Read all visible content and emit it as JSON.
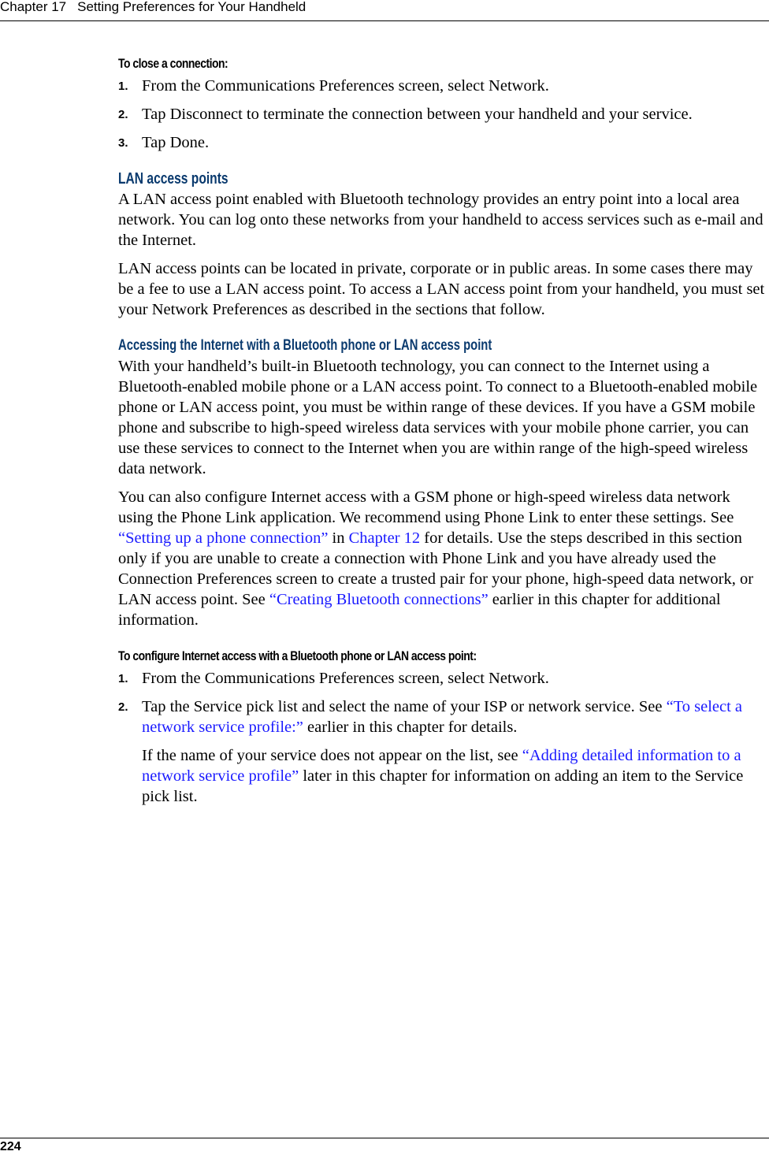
{
  "header": {
    "chapter": "Chapter 17",
    "title": "Setting Preferences for Your Handheld"
  },
  "footer": {
    "page_number": "224"
  },
  "close_connection": {
    "title": "To close a connection:",
    "steps": [
      {
        "num": "1.",
        "text": "From the Communications Preferences screen, select Network."
      },
      {
        "num": "2.",
        "text": "Tap Disconnect to terminate the connection between your handheld and your service."
      },
      {
        "num": "3.",
        "text": "Tap Done."
      }
    ]
  },
  "lan_access": {
    "title": "LAN access points",
    "paragraphs": [
      "A LAN access point enabled with Bluetooth technology provides an entry point into a local area network. You can log onto these networks from your handheld to access services such as e-mail and the Internet.",
      "LAN access points can be located in private, corporate or in public areas. In some cases there may be a fee to use a LAN access point. To access a LAN access point from your handheld, you must set your Network Preferences as described in the sections that follow."
    ]
  },
  "accessing": {
    "title": "Accessing the Internet with a Bluetooth phone or LAN access point",
    "para1": "With your handheld’s built-in Bluetooth technology, you can connect to the Internet using a Bluetooth-enabled mobile phone or a LAN access point. To connect to a Bluetooth-enabled mobile phone or LAN access point, you must be within range of these devices. If you have a GSM mobile phone and subscribe to high-speed wireless data services with your mobile phone carrier, you can use these services to connect to the Internet when you are within range of the high-speed wireless data network.",
    "para2": {
      "t1": "You can also configure Internet access with a GSM phone or high-speed wireless data network using the Phone Link application. We recommend using Phone Link to enter these settings. See ",
      "link1": "“Setting up a phone connection”",
      "t2": " in ",
      "link2": "Chapter 12",
      "t3": " for details. Use the steps described in this section only if you are unable to create a connection with Phone Link and you have already used the Connection Preferences screen to create a trusted pair for your phone, high-speed data network, or LAN access point. See ",
      "link3": "“Creating Bluetooth connections”",
      "t4": " earlier in this chapter for additional information."
    }
  },
  "configure": {
    "title": "To configure Internet access with a Bluetooth phone or LAN access point:",
    "step1": {
      "num": "1.",
      "text": "From the Communications Preferences screen, select Network."
    },
    "step2": {
      "num": "2.",
      "t1": "Tap the Service pick list and select the name of your ISP or network service. See ",
      "link": "“To select a network service profile:”",
      "t2": " earlier in this chapter for details."
    },
    "note": {
      "t1": "If the name of your service does not appear on the list, see ",
      "link": "“Adding detailed information to a network service profile”",
      "t2": " later in this chapter for information on adding an item to the Service pick list."
    }
  }
}
